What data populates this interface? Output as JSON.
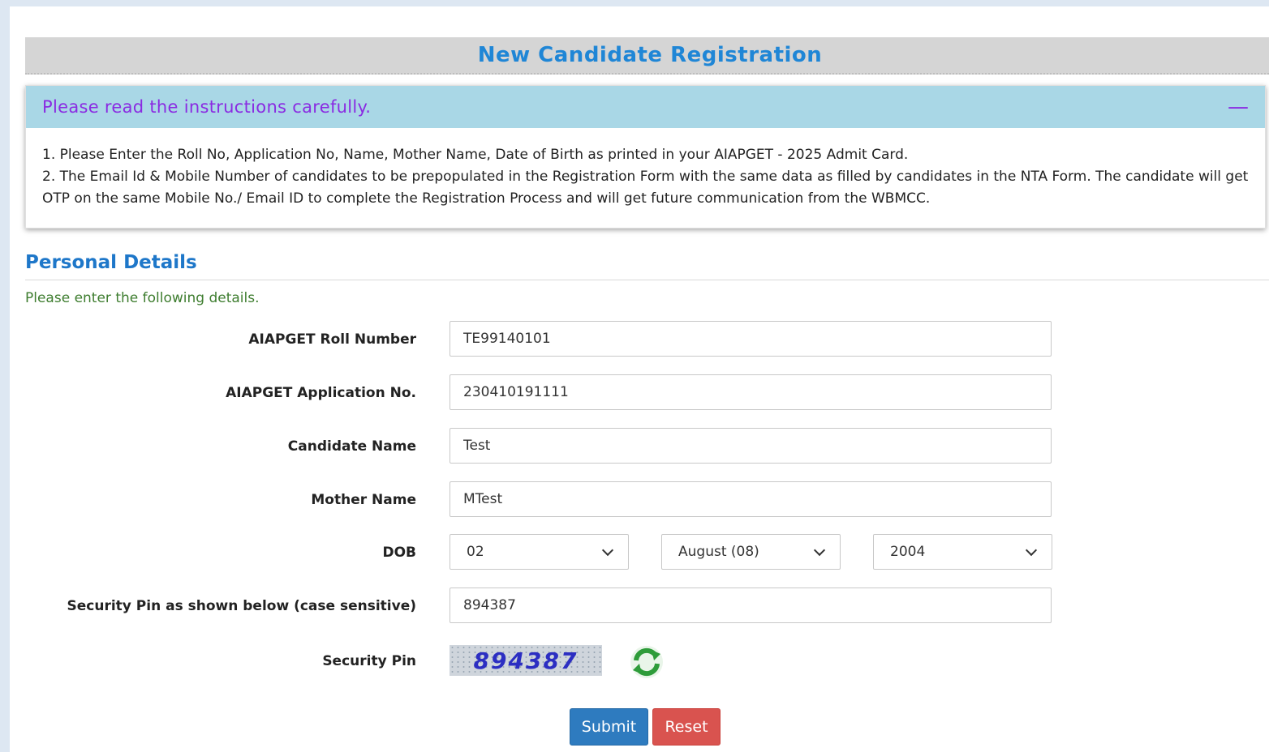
{
  "header": {
    "title": "New Candidate Registration"
  },
  "instructions": {
    "title": "Please read the instructions carefully.",
    "toggle": "—",
    "lines": [
      "1. Please Enter the Roll No, Application No, Name, Mother Name, Date of Birth as printed in your AIAPGET - 2025 Admit Card.",
      "2. The Email Id & Mobile Number of candidates to be prepopulated in the Registration Form with the same data as filled by candidates in the NTA Form. The candidate will get OTP on the same Mobile No./ Email ID to complete the Registration Process and will get future communication from the WBMCC."
    ]
  },
  "section": {
    "title": "Personal Details",
    "subtitle": "Please enter the following details."
  },
  "form": {
    "roll": {
      "label": "AIAPGET Roll Number",
      "value": "TE99140101"
    },
    "application": {
      "label": "AIAPGET Application No.",
      "value": "230410191111"
    },
    "name": {
      "label": "Candidate Name",
      "value": "Test"
    },
    "mother": {
      "label": "Mother Name",
      "value": "MTest"
    },
    "dob": {
      "label": "DOB",
      "day": "02",
      "month": "August (08)",
      "year": "2004"
    },
    "security_input": {
      "label": "Security Pin as shown below (case sensitive)",
      "value": "894387"
    },
    "security_pin": {
      "label": "Security Pin",
      "captcha": "894387"
    }
  },
  "buttons": {
    "submit": "Submit",
    "reset": "Reset"
  },
  "colors": {
    "accent": "#1f86d6",
    "submit": "#2e7bbf",
    "reset": "#d9534f",
    "instruction_header": "#a9d7e6"
  },
  "icons": {
    "refresh": "refresh-captcha-icon"
  }
}
